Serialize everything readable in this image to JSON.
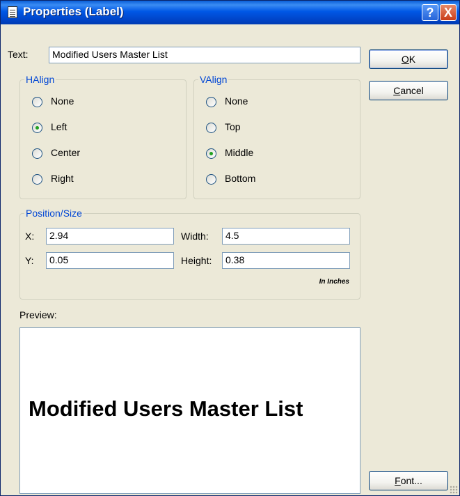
{
  "window": {
    "title": "Properties (Label)",
    "help": "?",
    "close": "X"
  },
  "text_field": {
    "label": "Text:",
    "value": "Modified Users Master List"
  },
  "halign": {
    "legend": "HAlign",
    "options": [
      {
        "label": "None",
        "checked": false
      },
      {
        "label": "Left",
        "checked": true
      },
      {
        "label": "Center",
        "checked": false
      },
      {
        "label": "Right",
        "checked": false
      }
    ]
  },
  "valign": {
    "legend": "VAlign",
    "options": [
      {
        "label": "None",
        "checked": false
      },
      {
        "label": "Top",
        "checked": false
      },
      {
        "label": "Middle",
        "checked": true
      },
      {
        "label": "Bottom",
        "checked": false
      }
    ]
  },
  "position_size": {
    "legend": "Position/Size",
    "x_label": "X:",
    "x_value": "2.94",
    "y_label": "Y:",
    "y_value": "0.05",
    "width_label": "Width:",
    "width_value": "4.5",
    "height_label": "Height:",
    "height_value": "0.38",
    "units_note": "In Inches"
  },
  "preview": {
    "label": "Preview:",
    "text": "Modified Users Master List"
  },
  "buttons": {
    "ok": {
      "accel": "O",
      "rest": "K"
    },
    "cancel": {
      "accel": "C",
      "rest": "ancel"
    },
    "font": {
      "accel": "F",
      "rest": "ont..."
    }
  },
  "colors": {
    "title_bar": "#0058e6",
    "group_legend": "#0046d5",
    "dialog_bg": "#ece9d8",
    "radio_dot": "#21a121"
  }
}
